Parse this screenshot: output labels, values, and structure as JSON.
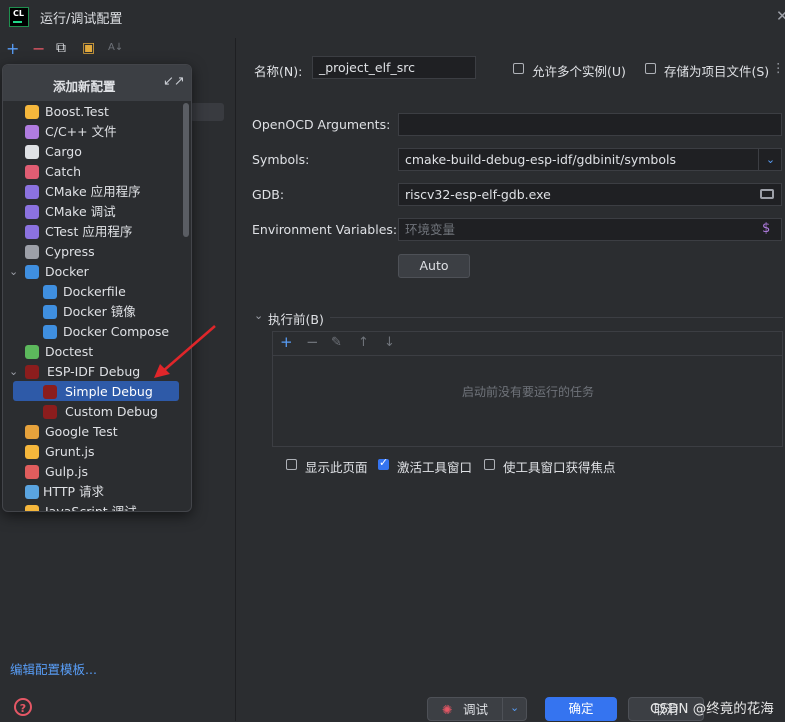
{
  "window": {
    "title": "运行/调试配置",
    "app_icon_text": "CL",
    "close_glyph": "✕"
  },
  "left": {
    "toolbar": {
      "add": "+",
      "remove": "−",
      "copy": "⧉",
      "folder": "▣",
      "sort": "A↓"
    },
    "edit_templates_link": "编辑配置模板...",
    "help_glyph": "?"
  },
  "popup": {
    "title": "添加新配置",
    "items": [
      {
        "label": "Boost.Test",
        "icon_color": "#f5b73c"
      },
      {
        "label": "C/C++ 文件",
        "icon_color": "#b07ce0"
      },
      {
        "label": "Cargo",
        "icon_color": "#dfe1e5"
      },
      {
        "label": "Catch",
        "icon_color": "#e05d73"
      },
      {
        "label": "CMake 应用程序",
        "icon_color": "#8b72e0"
      },
      {
        "label": "CMake 调试",
        "icon_color": "#8b72e0"
      },
      {
        "label": "CTest 应用程序",
        "icon_color": "#8b72e0"
      },
      {
        "label": "Cypress",
        "icon_color": "#9da0a8"
      },
      {
        "label": "Docker",
        "icon_color": "#3f8fe0"
      },
      {
        "label": "Dockerfile",
        "icon_color": "#3f8fe0"
      },
      {
        "label": "Docker 镜像",
        "icon_color": "#3f8fe0"
      },
      {
        "label": "Docker Compose",
        "icon_color": "#3f8fe0"
      },
      {
        "label": "Doctest",
        "icon_color": "#5cb85c"
      },
      {
        "label": "ESP-IDF Debug",
        "icon_color": "#8b1d1d"
      },
      {
        "label": "Simple Debug",
        "icon_color": "#8b1d1d"
      },
      {
        "label": "Custom Debug",
        "icon_color": "#8b1d1d"
      },
      {
        "label": "Google Test",
        "icon_color": "#e6a23c"
      },
      {
        "label": "Grunt.js",
        "icon_color": "#f5b73c"
      },
      {
        "label": "Gulp.js",
        "icon_color": "#e05d5d"
      },
      {
        "label": "HTTP 请求",
        "icon_color": "#5aa4e0"
      },
      {
        "label": "JavaScript 调试",
        "icon_color": "#f5b73c"
      }
    ]
  },
  "form": {
    "name_label": "名称(N):",
    "name_value": "_project_elf_src",
    "allow_multiple_label": "允许多个实例(U)",
    "store_as_project_label": "存储为项目文件(S)",
    "more_glyph": "⋮",
    "openocd_label": "OpenOCD Arguments:",
    "openocd_value": "",
    "symbols_label": "Symbols:",
    "symbols_value": "cmake-build-debug-esp-idf/gdbinit/symbols",
    "gdb_label": "GDB:",
    "gdb_value": "riscv32-esp-elf-gdb.exe",
    "env_label": "Environment Variables:",
    "env_placeholder": "环境变量",
    "env_glyph": "$",
    "auto_button": "Auto",
    "before_launch_label": "执行前(B)",
    "before_launch_empty": "启动前没有要运行的任务",
    "show_page_label": "显示此页面",
    "activate_window_label": "激活工具窗口",
    "focus_window_label": "使工具窗口获得焦点"
  },
  "bottom": {
    "debug_button": "调试",
    "ok_button": "确定",
    "cancel_button": "取消",
    "watermark": "CSDN @终竟的花海"
  },
  "colors": {
    "accent": "#3574f0",
    "selection": "#2e5aa8",
    "arrow": "#e0262a"
  }
}
